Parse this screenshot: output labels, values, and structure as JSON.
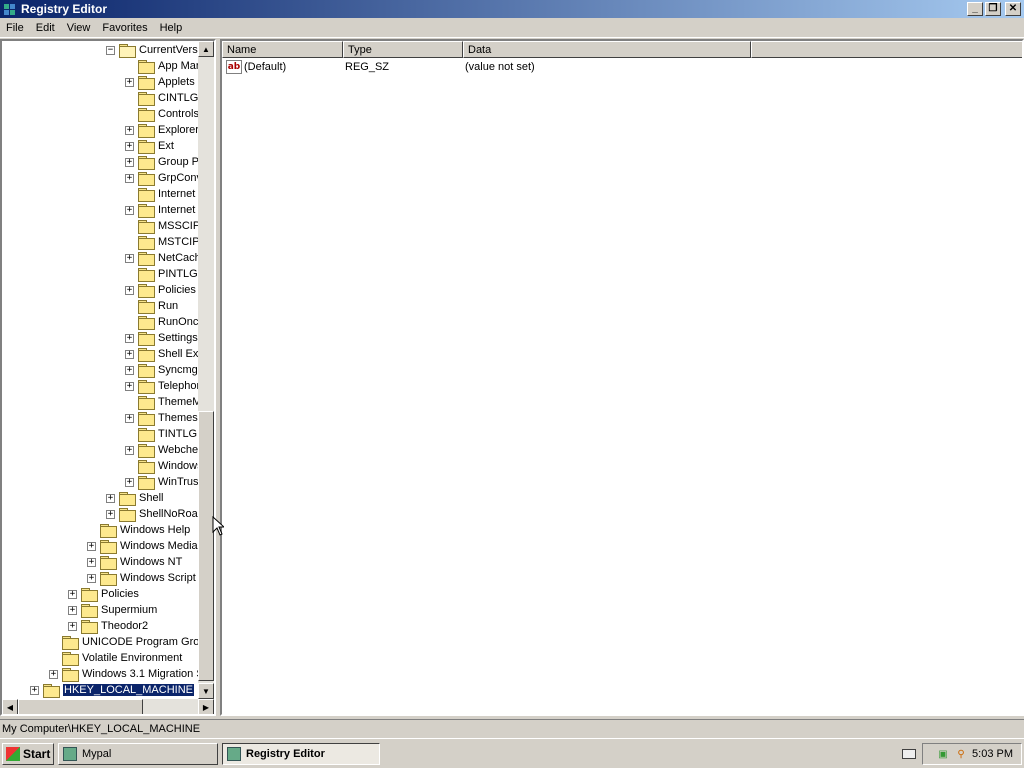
{
  "window": {
    "title": "Registry Editor"
  },
  "window_buttons": {
    "minimize": "_",
    "maximize": "❐",
    "close": "✕"
  },
  "menu": [
    "File",
    "Edit",
    "View",
    "Favorites",
    "Help"
  ],
  "tree": [
    {
      "label": "CurrentVers",
      "expander": "−",
      "open": true
    },
    {
      "label": "App Mar",
      "expander": ""
    },
    {
      "label": "Applets",
      "expander": "+"
    },
    {
      "label": "CINTLGN",
      "expander": ""
    },
    {
      "label": "Controls",
      "expander": ""
    },
    {
      "label": "Explorer",
      "expander": "+"
    },
    {
      "label": "Ext",
      "expander": "+"
    },
    {
      "label": "Group P",
      "expander": "+"
    },
    {
      "label": "GrpConv",
      "expander": "+"
    },
    {
      "label": "Internet",
      "expander": ""
    },
    {
      "label": "Internet",
      "expander": "+"
    },
    {
      "label": "MSSCIPI",
      "expander": ""
    },
    {
      "label": "MSTCIPH",
      "expander": ""
    },
    {
      "label": "NetCach",
      "expander": "+"
    },
    {
      "label": "PINTLGN",
      "expander": ""
    },
    {
      "label": "Policies",
      "expander": "+"
    },
    {
      "label": "Run",
      "expander": ""
    },
    {
      "label": "RunOnce",
      "expander": ""
    },
    {
      "label": "Settings",
      "expander": "+"
    },
    {
      "label": "Shell Ext",
      "expander": "+"
    },
    {
      "label": "Syncmgr",
      "expander": "+"
    },
    {
      "label": "Telephor",
      "expander": "+"
    },
    {
      "label": "ThemeM",
      "expander": ""
    },
    {
      "label": "Themes",
      "expander": "+"
    },
    {
      "label": "TINTLGN",
      "expander": ""
    },
    {
      "label": "Webche",
      "expander": "+"
    },
    {
      "label": "Windows",
      "expander": ""
    },
    {
      "label": "WinTrus",
      "expander": "+"
    },
    {
      "label": "Shell",
      "expander": "+"
    },
    {
      "label": "ShellNoRoam",
      "expander": "+"
    },
    {
      "label": "Windows Help",
      "expander": ""
    },
    {
      "label": "Windows Media",
      "expander": "+"
    },
    {
      "label": "Windows NT",
      "expander": "+"
    },
    {
      "label": "Windows Script H",
      "expander": "+"
    },
    {
      "label": "Policies",
      "expander": "+"
    },
    {
      "label": "Supermium",
      "expander": "+"
    },
    {
      "label": "Theodor2",
      "expander": "+"
    },
    {
      "label": "UNICODE Program Grou",
      "expander": ""
    },
    {
      "label": "Volatile Environment",
      "expander": ""
    },
    {
      "label": "Windows 3.1 Migration S",
      "expander": "+"
    },
    {
      "label": "HKEY_LOCAL_MACHINE",
      "expander": "+",
      "selected": true
    }
  ],
  "scroll": {
    "up": "▲",
    "down": "▼",
    "left": "◀",
    "right": "▶"
  },
  "columns": [
    "Name",
    "Type",
    "Data"
  ],
  "values": [
    {
      "icon": "ab",
      "name": "(Default)",
      "type": "REG_SZ",
      "data": "(value not set)"
    }
  ],
  "status": "My Computer\\HKEY_LOCAL_MACHINE",
  "taskbar": {
    "start": "Start",
    "tasks": [
      {
        "label": "Mypal",
        "active": false
      },
      {
        "label": "Registry Editor",
        "active": true
      }
    ],
    "clock": "5:03 PM"
  }
}
